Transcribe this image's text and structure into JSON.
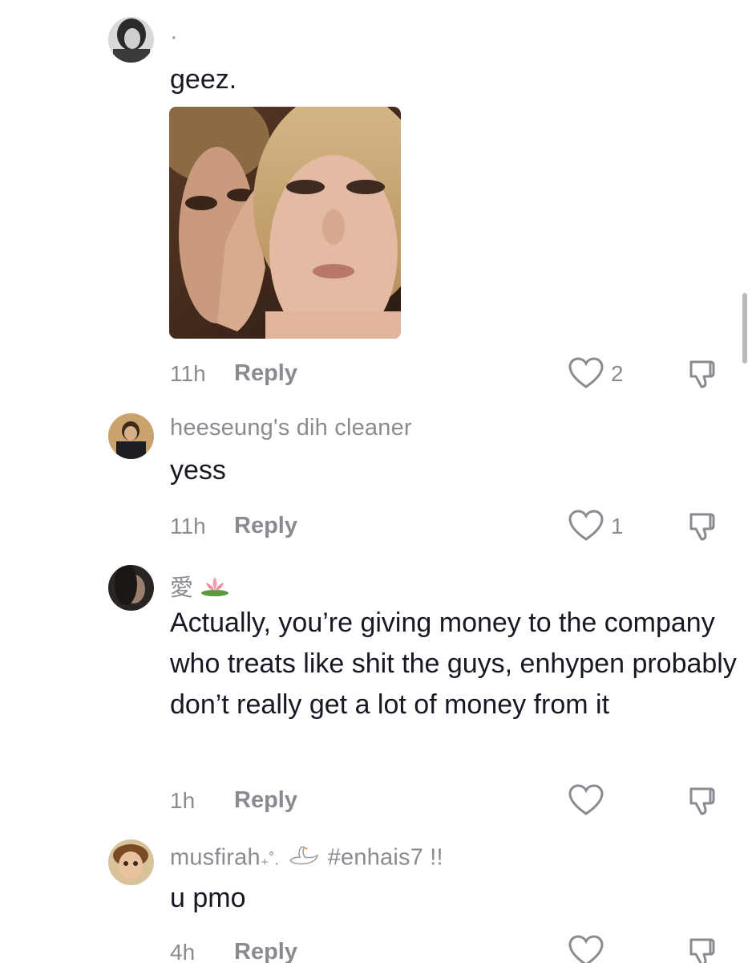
{
  "comments": [
    {
      "username": "·",
      "text": "geez.",
      "time": "11h",
      "reply_label": "Reply",
      "likes": "2"
    },
    {
      "username": "heeseung's dih cleaner",
      "text": "yess",
      "time": "11h",
      "reply_label": "Reply",
      "likes": "1"
    },
    {
      "username": "愛",
      "text": "Actually, you’re giving money to the company who treats like shit the guys, enhypen probably don’t really get a lot of money from it",
      "time": "1h",
      "reply_label": "Reply",
      "likes": ""
    },
    {
      "username_prefix": "musfirah",
      "username_suffix": "#enhais7 !!",
      "text": "u pmo",
      "time": "4h",
      "reply_label": "Reply",
      "likes": ""
    }
  ],
  "icons": {
    "like": "heart-outline-icon",
    "dislike": "thumbs-down-icon",
    "lotus": "lotus-icon",
    "swan": "swan-icon"
  },
  "colors": {
    "text": "#161823",
    "secondary": "#8a8b91",
    "background": "#ffffff"
  }
}
